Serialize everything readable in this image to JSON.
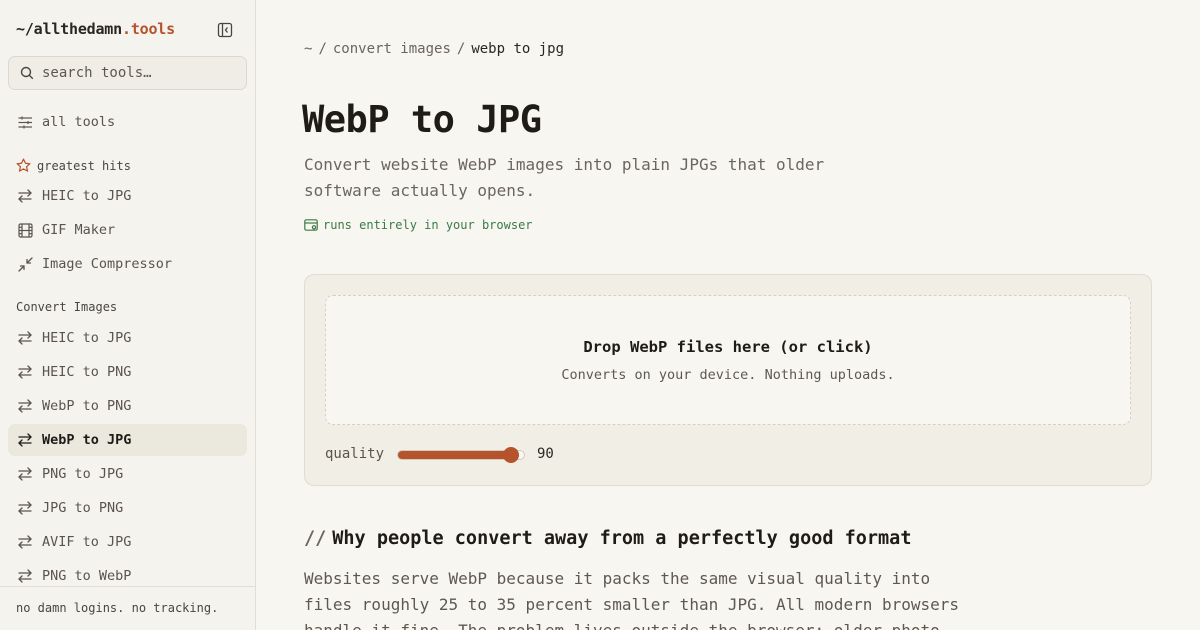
{
  "brand": {
    "prefix": "~/allthedamn",
    "accent": ".tools"
  },
  "search": {
    "placeholder": "search tools…"
  },
  "sidebar": {
    "all_tools": "all tools",
    "greatest_hits": {
      "heading": "greatest hits",
      "items": [
        {
          "label": "HEIC to JPG",
          "icon": "convert-arrows-icon"
        },
        {
          "label": "GIF Maker",
          "icon": "film-icon"
        },
        {
          "label": "Image Compressor",
          "icon": "compress-icon"
        }
      ]
    },
    "convert_images": {
      "heading": "Convert Images",
      "items": [
        {
          "label": "HEIC to JPG",
          "icon": "convert-arrows-icon"
        },
        {
          "label": "HEIC to PNG",
          "icon": "convert-arrows-icon"
        },
        {
          "label": "WebP to PNG",
          "icon": "convert-arrows-icon"
        },
        {
          "label": "WebP to JPG",
          "icon": "convert-arrows-icon",
          "active": true
        },
        {
          "label": "PNG to JPG",
          "icon": "convert-arrows-icon"
        },
        {
          "label": "JPG to PNG",
          "icon": "convert-arrows-icon"
        },
        {
          "label": "AVIF to JPG",
          "icon": "convert-arrows-icon"
        },
        {
          "label": "PNG to WebP",
          "icon": "convert-arrows-icon"
        }
      ]
    },
    "footer": "no damn logins. no tracking."
  },
  "breadcrumb": {
    "home": "~",
    "section": "convert images",
    "current": "webp to jpg"
  },
  "page": {
    "title": "WebP to JPG",
    "subtitle": "Convert website WebP images into plain JPGs that older software actually opens.",
    "badge": "runs entirely in your browser"
  },
  "tool": {
    "drop_title": "Drop WebP files here (or click)",
    "drop_sub": "Converts on your device. Nothing uploads.",
    "quality_label": "quality",
    "quality_value": 90,
    "quality_min": 1,
    "quality_max": 100
  },
  "article": {
    "heading_mark": "//",
    "heading": "Why people convert away from a perfectly good format",
    "paragraph": "Websites serve WebP because it packs the same visual quality into files roughly 25 to 35 percent smaller than JPG. All modern browsers handle it fine. The problem lives outside the browser: older photo"
  },
  "colors": {
    "accent": "#b5532d",
    "badge_green": "#3a7a45",
    "background": "#f8f6f1"
  }
}
